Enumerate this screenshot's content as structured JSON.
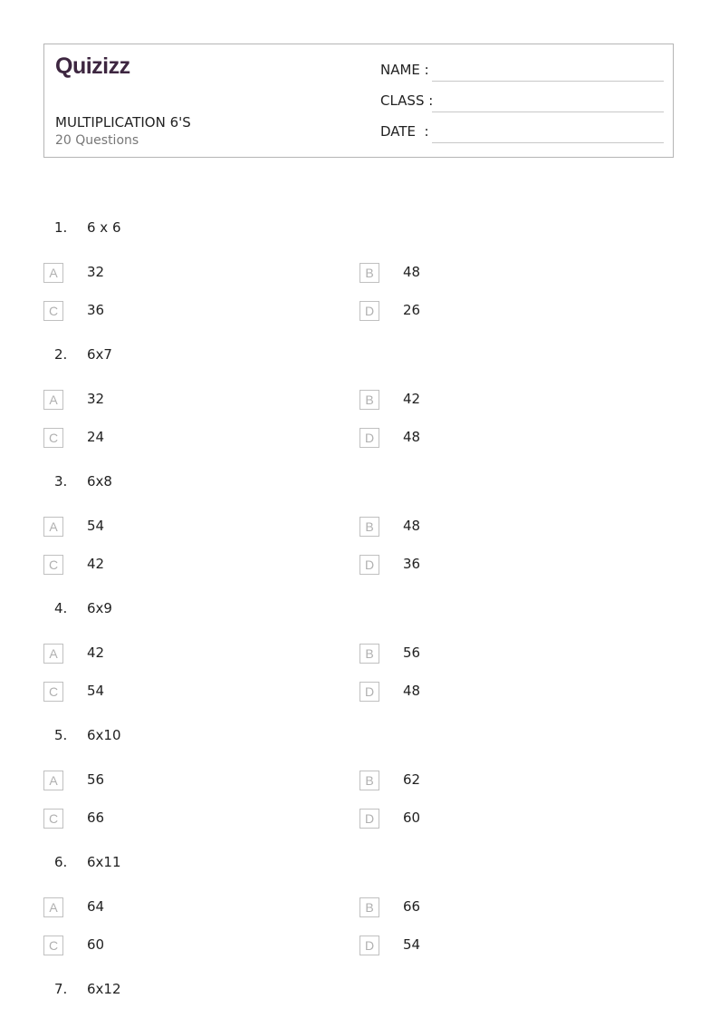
{
  "header": {
    "logo": "Quizizz",
    "title": "MULTIPLICATION 6'S",
    "subtitle": "20 Questions",
    "fields": [
      {
        "label": "NAME :"
      },
      {
        "label": "CLASS :"
      },
      {
        "label": "DATE  :"
      }
    ]
  },
  "questions": [
    {
      "num": "1.",
      "text": "6 x 6",
      "options": [
        {
          "letter": "A",
          "text": "32"
        },
        {
          "letter": "B",
          "text": "48"
        },
        {
          "letter": "C",
          "text": "36"
        },
        {
          "letter": "D",
          "text": "26"
        }
      ]
    },
    {
      "num": "2.",
      "text": "6x7",
      "options": [
        {
          "letter": "A",
          "text": "32"
        },
        {
          "letter": "B",
          "text": "42"
        },
        {
          "letter": "C",
          "text": "24"
        },
        {
          "letter": "D",
          "text": "48"
        }
      ]
    },
    {
      "num": "3.",
      "text": "6x8",
      "options": [
        {
          "letter": "A",
          "text": "54"
        },
        {
          "letter": "B",
          "text": "48"
        },
        {
          "letter": "C",
          "text": "42"
        },
        {
          "letter": "D",
          "text": "36"
        }
      ]
    },
    {
      "num": "4.",
      "text": "6x9",
      "options": [
        {
          "letter": "A",
          "text": "42"
        },
        {
          "letter": "B",
          "text": "56"
        },
        {
          "letter": "C",
          "text": "54"
        },
        {
          "letter": "D",
          "text": "48"
        }
      ]
    },
    {
      "num": "5.",
      "text": "6x10",
      "options": [
        {
          "letter": "A",
          "text": "56"
        },
        {
          "letter": "B",
          "text": "62"
        },
        {
          "letter": "C",
          "text": "66"
        },
        {
          "letter": "D",
          "text": "60"
        }
      ]
    },
    {
      "num": "6.",
      "text": "6x11",
      "options": [
        {
          "letter": "A",
          "text": "64"
        },
        {
          "letter": "B",
          "text": "66"
        },
        {
          "letter": "C",
          "text": "60"
        },
        {
          "letter": "D",
          "text": "54"
        }
      ]
    },
    {
      "num": "7.",
      "text": "6x12",
      "options": []
    }
  ]
}
